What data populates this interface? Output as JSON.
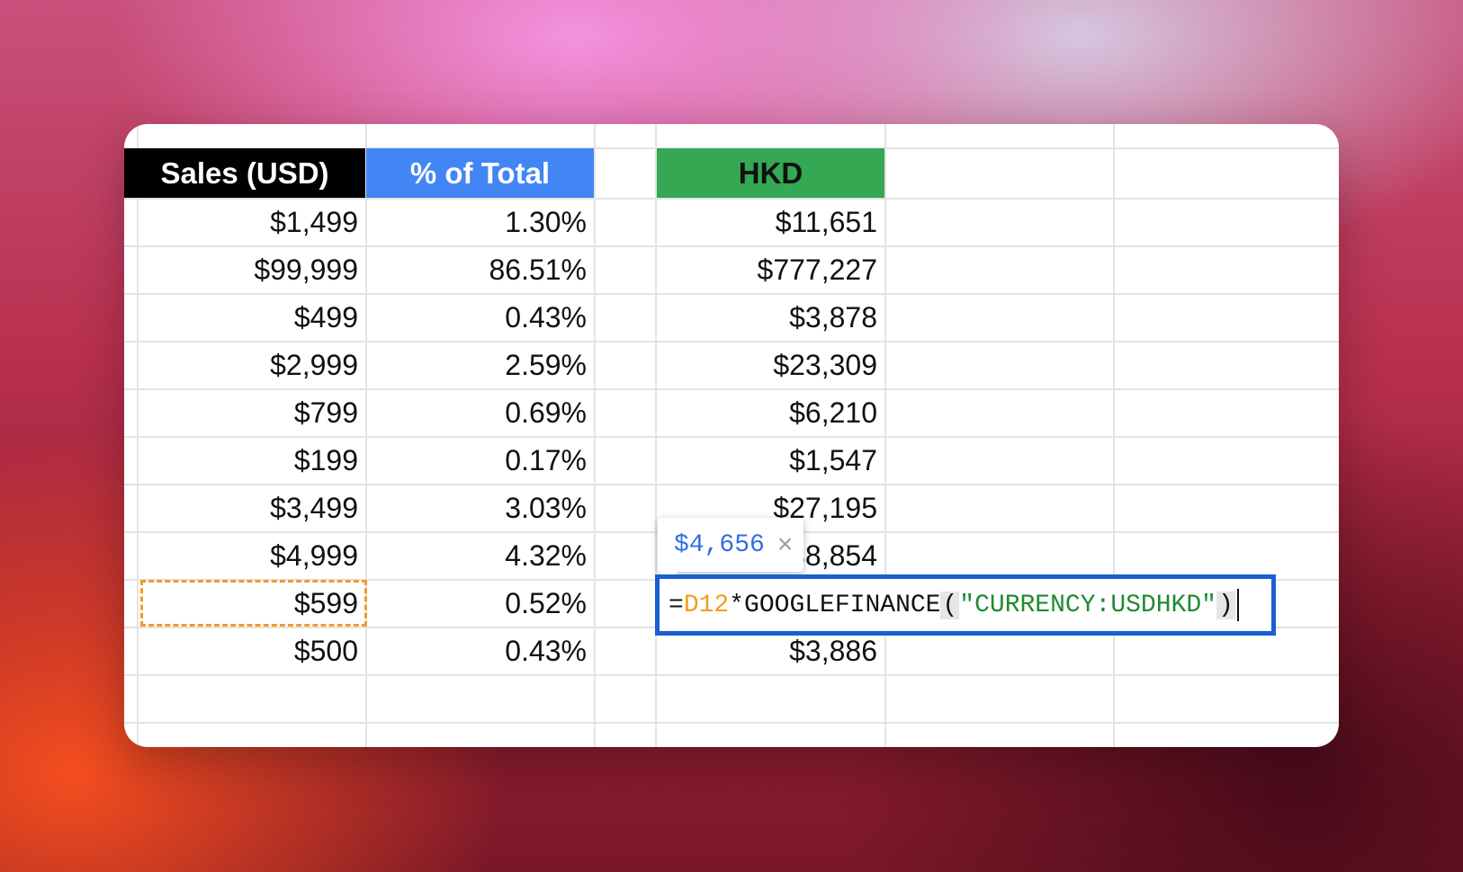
{
  "sheet": {
    "headers": {
      "sales": "Sales (USD)",
      "percent": "% of Total",
      "hkd": "HKD"
    },
    "header_colors": {
      "sales_bg": "#000000",
      "percent_bg": "#4285f4",
      "hkd_bg": "#34a853"
    },
    "rows": [
      {
        "sales": "$1,499",
        "percent": "1.30%",
        "hkd": "$11,651"
      },
      {
        "sales": "$99,999",
        "percent": "86.51%",
        "hkd": "$777,227"
      },
      {
        "sales": "$499",
        "percent": "0.43%",
        "hkd": "$3,878"
      },
      {
        "sales": "$2,999",
        "percent": "2.59%",
        "hkd": "$23,309"
      },
      {
        "sales": "$799",
        "percent": "0.69%",
        "hkd": "$6,210"
      },
      {
        "sales": "$199",
        "percent": "0.17%",
        "hkd": "$1,547"
      },
      {
        "sales": "$3,499",
        "percent": "3.03%",
        "hkd": "$27,195"
      },
      {
        "sales": "$4,999",
        "percent": "4.32%",
        "hkd": "$38,854"
      },
      {
        "sales": "$599",
        "percent": "0.52%",
        "hkd": ""
      },
      {
        "sales": "$500",
        "percent": "0.43%",
        "hkd": "$3,886"
      }
    ],
    "referenced_row": 8
  },
  "tooltip": {
    "value": "$4,656",
    "close_icon": "close-icon"
  },
  "formula": {
    "eq": "=",
    "ref": "D12",
    "op": "*GOOGLEFINANCE",
    "open_paren": "(",
    "arg": "\"CURRENCY:USDHKD\"",
    "close_paren": ")",
    "ref_color": "#f39c1d",
    "string_color": "#1f8a31",
    "border_color": "#1a5fd0"
  }
}
